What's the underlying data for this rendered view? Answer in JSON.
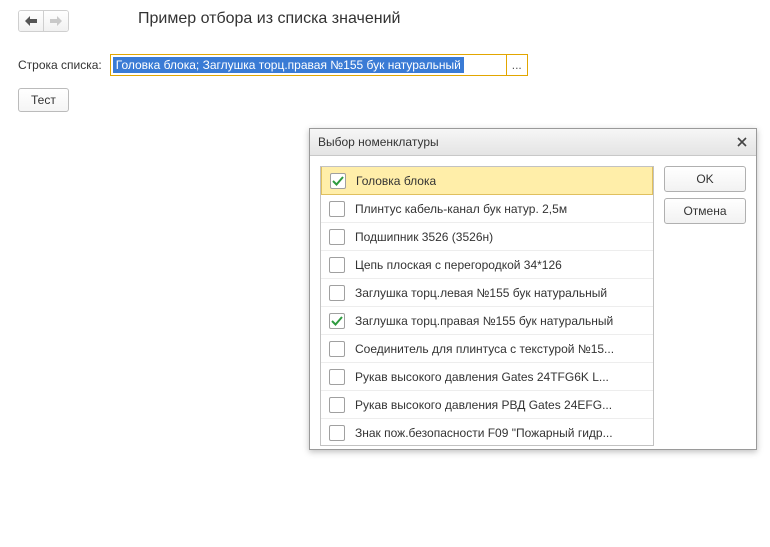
{
  "header": {
    "title": "Пример отбора из списка значений"
  },
  "string_row": {
    "label": "Строка списка:",
    "value": "Головка блока; Заглушка торц.правая №155 бук натуральный",
    "select_btn": "..."
  },
  "test_btn": "Тест",
  "dialog": {
    "title": "Выбор номенклатуры",
    "ok": "OK",
    "cancel": "Отмена",
    "items": [
      {
        "label": "Головка блока",
        "checked": true,
        "selected": true
      },
      {
        "label": "Плинтус кабель-канал бук натур. 2,5м",
        "checked": false,
        "selected": false
      },
      {
        "label": "Подшипник 3526 (3526н)",
        "checked": false,
        "selected": false
      },
      {
        "label": "Цепь плоская с перегородкой 34*126",
        "checked": false,
        "selected": false
      },
      {
        "label": "Заглушка торц.левая №155 бук натуральный",
        "checked": false,
        "selected": false
      },
      {
        "label": "Заглушка торц.правая №155 бук натуральный",
        "checked": true,
        "selected": false
      },
      {
        "label": "Соединитель для плинтуса с текстурой №15...",
        "checked": false,
        "selected": false
      },
      {
        "label": "Рукав высокого давления Gates 24TFG6K L...",
        "checked": false,
        "selected": false
      },
      {
        "label": "Рукав высокого давления РВД Gates 24EFG...",
        "checked": false,
        "selected": false
      },
      {
        "label": "Знак пож.безопасности F09 \"Пожарный гидр...",
        "checked": false,
        "selected": false
      }
    ]
  }
}
